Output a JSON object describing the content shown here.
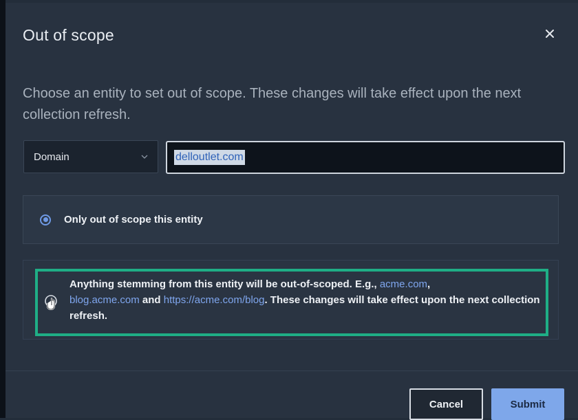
{
  "dialog": {
    "title": "Out of scope",
    "description": "Choose an entity to set out of scope. These changes will take effect upon the next collection refresh.",
    "entity_type": {
      "selected": "Domain"
    },
    "entity_input": {
      "value": "delloutlet.com"
    },
    "options": [
      {
        "label": "Only out of scope this entity",
        "selected": true
      },
      {
        "selected": false,
        "text_part1": "Anything stemming from this entity will be out-of-scoped. E.g., ",
        "link1": "acme.com",
        "text_part2": ", ",
        "link2": "blog.acme.com",
        "text_part3": " and ",
        "link3": "https://acme.com/blog",
        "text_part4": ". These changes will take effect upon the next collection refresh."
      }
    ],
    "buttons": {
      "cancel": "Cancel",
      "submit": "Submit"
    }
  },
  "icons": {
    "close": "close-icon",
    "dropdown": "chevron-down-icon",
    "cursor": "hand-pointer-cursor-icon"
  },
  "colors": {
    "background": "#283240",
    "accent": "#7ea7ea",
    "highlight": "#1fae86",
    "link": "#7fa6ee"
  }
}
